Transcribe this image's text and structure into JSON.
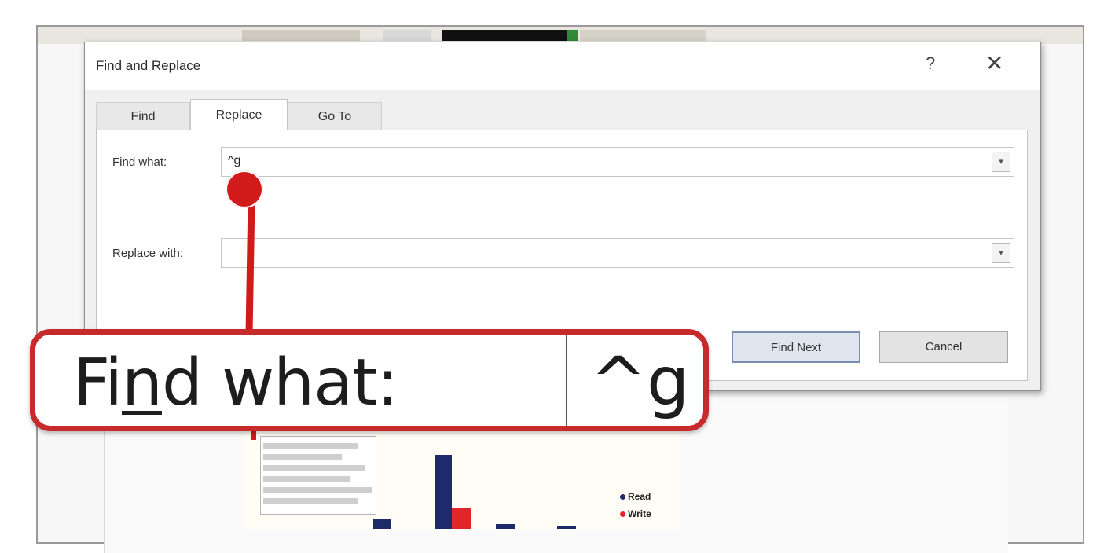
{
  "dialog": {
    "title": "Find and Replace",
    "help_glyph": "?",
    "close_glyph": "✕",
    "tabs": [
      {
        "label": "Find",
        "active": false
      },
      {
        "label": "Replace",
        "active": true
      },
      {
        "label": "Go To",
        "active": false
      }
    ],
    "find_what": {
      "label": "Find what:",
      "value": "^g"
    },
    "replace_with": {
      "label": "Replace with:",
      "value": ""
    },
    "dropdown_glyph": "▾",
    "buttons": {
      "find_next": "Find Next",
      "cancel": "Cancel"
    }
  },
  "callout": {
    "label_pre": "Fi",
    "label_underlined": "n",
    "label_post": "d what:",
    "value": "^g",
    "color": "#c62a2a"
  },
  "chart_thumbnail": {
    "legend": [
      "Read",
      "Write"
    ],
    "colors": {
      "read": "#1f2a6b",
      "write": "#e0262b"
    }
  }
}
